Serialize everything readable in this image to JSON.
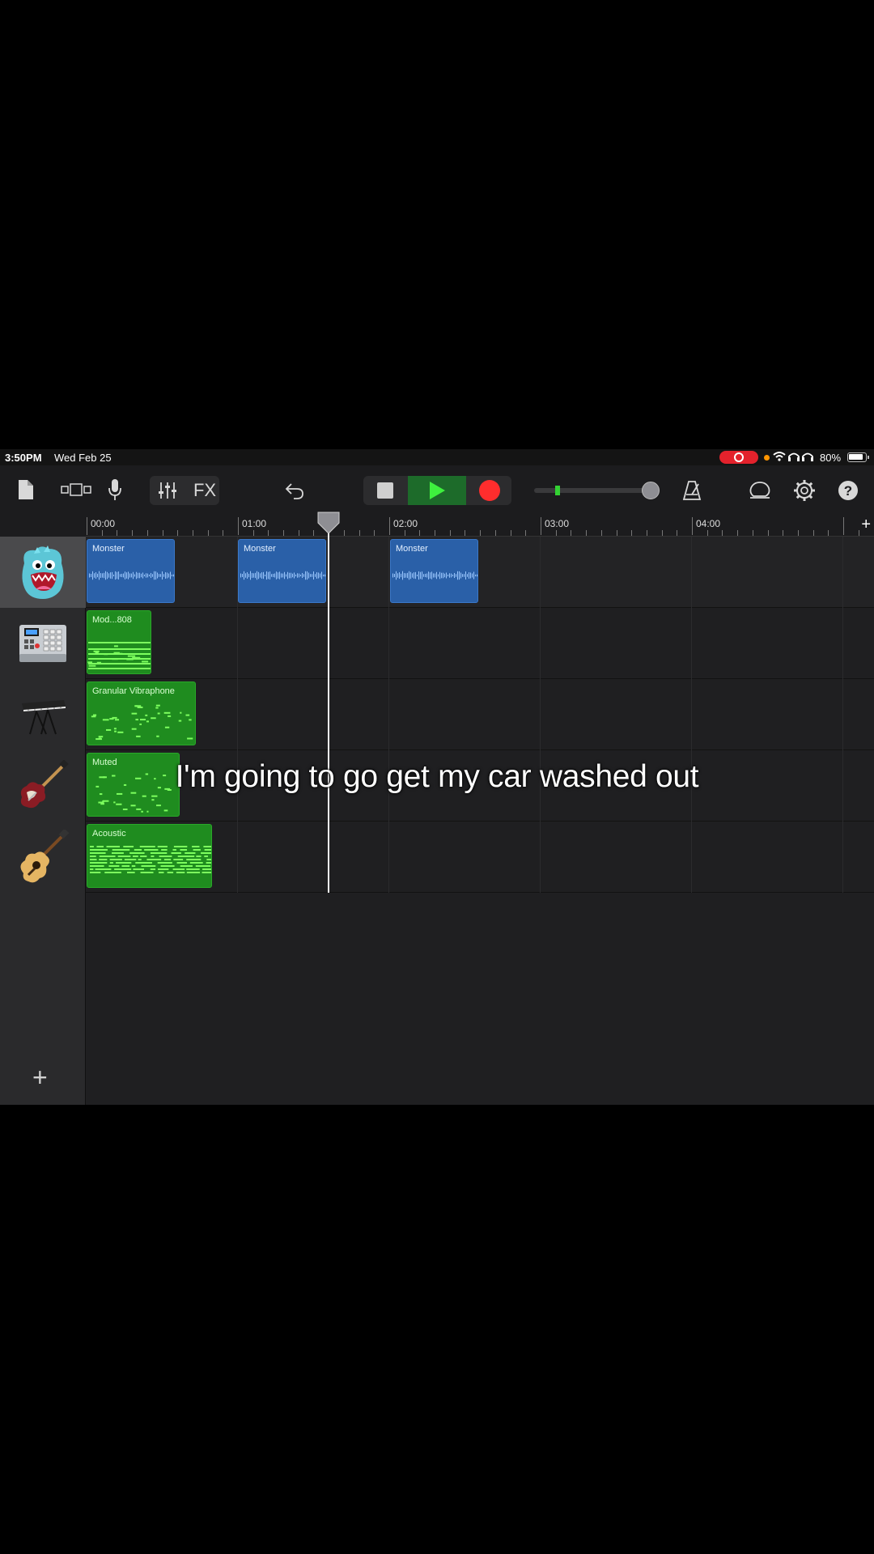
{
  "status_bar": {
    "time": "3:50PM",
    "date": "Wed Feb 25",
    "battery": "80%"
  },
  "toolbar": {
    "fx_label": "FX",
    "icons": [
      "document-icon",
      "view-toggle-icon",
      "microphone-icon",
      "mixer-icon",
      "undo-icon",
      "stop-icon",
      "play-icon",
      "record-icon",
      "metronome-icon",
      "loop-icon",
      "settings-icon",
      "help-icon"
    ],
    "colors": {
      "play_bg": "#1d6b2a",
      "record": "#ff2d2d"
    }
  },
  "ruler": {
    "labels": [
      "00:00",
      "01:00",
      "02:00",
      "03:00",
      "04:00"
    ]
  },
  "tracks": [
    {
      "instrument": "monster-vocal-icon",
      "selected": true,
      "regions": [
        {
          "name": "Monster",
          "type": "audio"
        },
        {
          "name": "Monster",
          "type": "audio"
        },
        {
          "name": "Monster",
          "type": "audio"
        }
      ]
    },
    {
      "instrument": "drum-machine-icon",
      "selected": false,
      "regions": [
        {
          "name": "Mod...808",
          "type": "midi"
        }
      ]
    },
    {
      "instrument": "keyboard-icon",
      "selected": false,
      "regions": [
        {
          "name": "Granular Vibraphone",
          "type": "midi"
        }
      ]
    },
    {
      "instrument": "bass-guitar-icon",
      "selected": false,
      "regions": [
        {
          "name": "Muted",
          "type": "midi"
        }
      ]
    },
    {
      "instrument": "acoustic-guitar-icon",
      "selected": false,
      "regions": [
        {
          "name": "Acoustic",
          "type": "midi"
        }
      ]
    }
  ],
  "caption": "I'm going to go get my car washed out",
  "add_track_label": "+"
}
